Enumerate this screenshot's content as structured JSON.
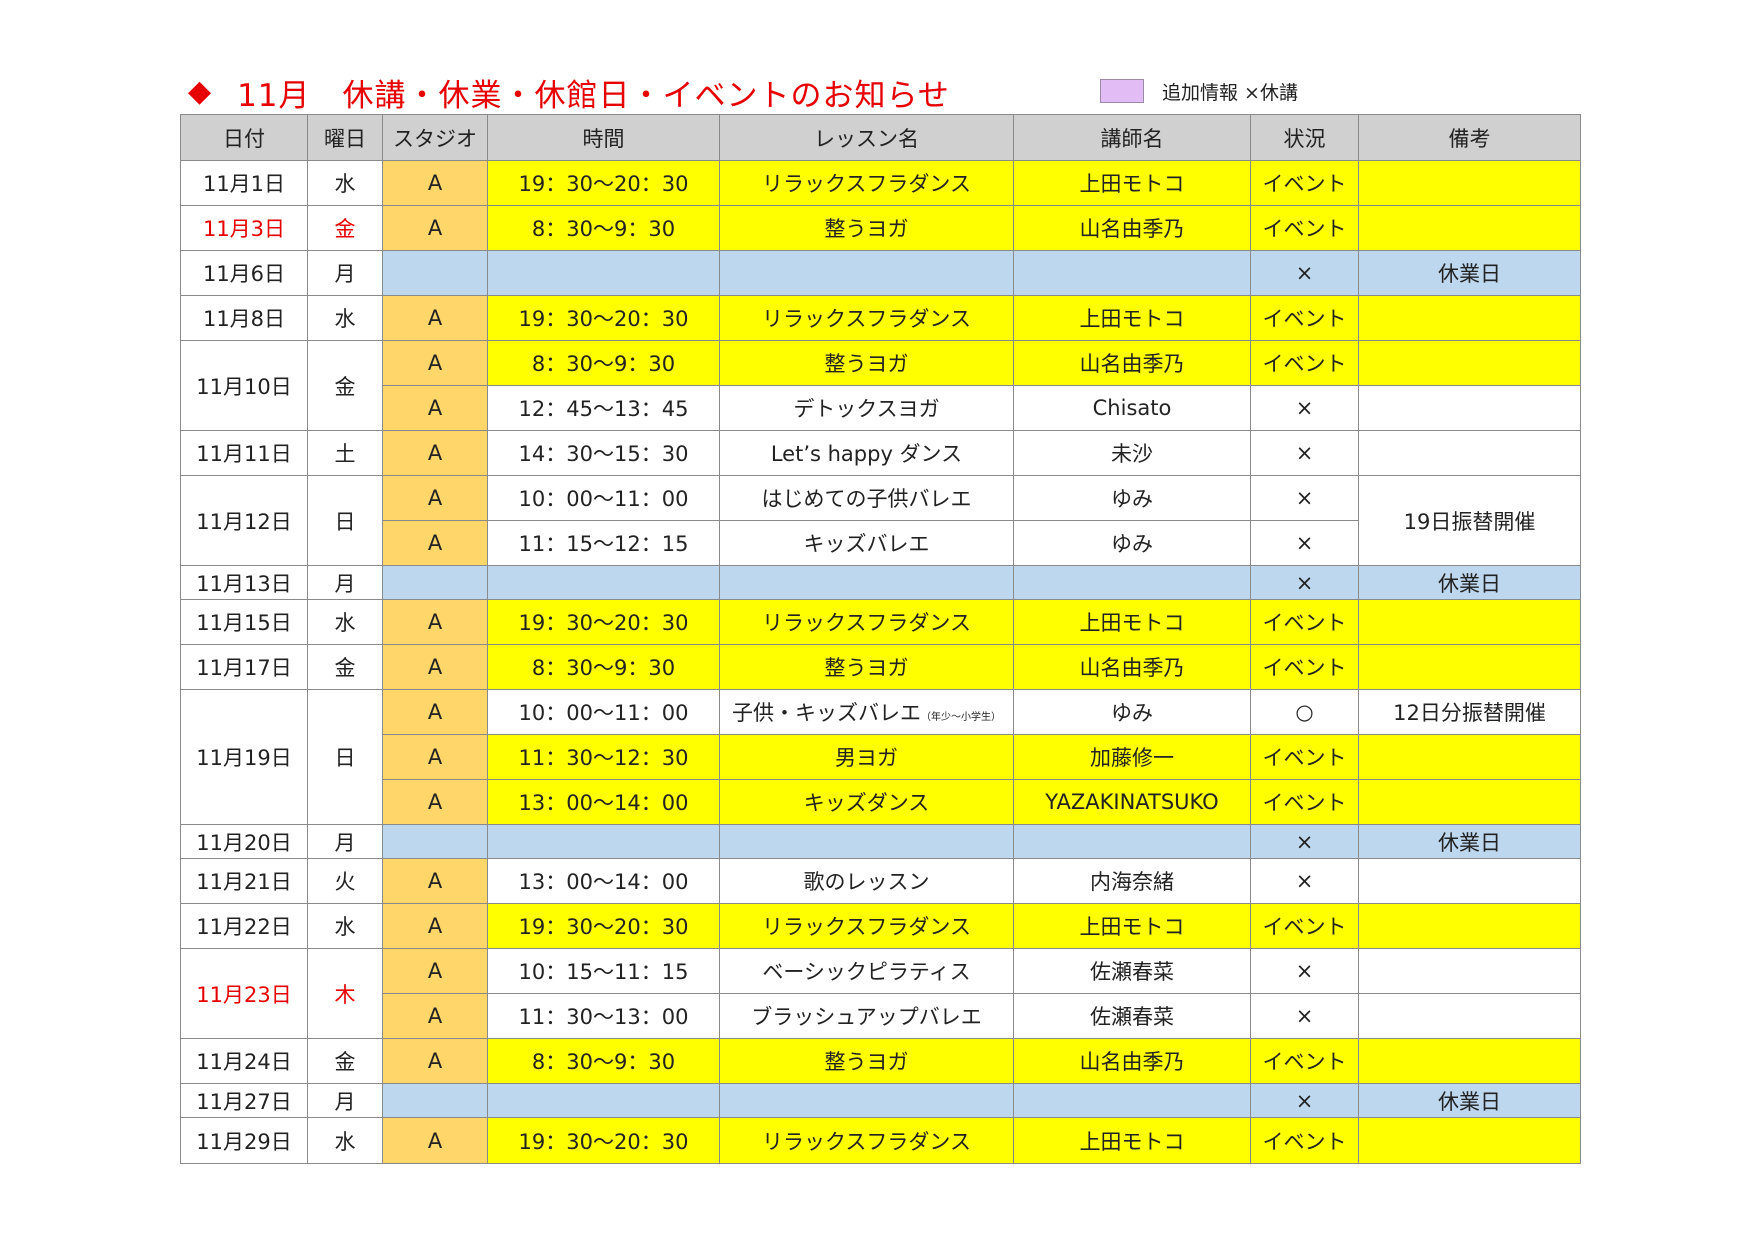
{
  "title": {
    "bullet": "◆",
    "text": "11月　休講・休業・休館日・イベントのお知らせ"
  },
  "legend": {
    "text": "追加情報 ×休講",
    "swatch_color": "#e2bdf5"
  },
  "colors": {
    "title_red": "#e60000",
    "header_gray": "#d0d0d0",
    "studio_orange": "#ffd66a",
    "event_yellow": "#ffff00",
    "closed_blue": "#bdd7ee"
  },
  "headers": [
    "日付",
    "曜日",
    "スタジオ",
    "時間",
    "レッスン名",
    "講師名",
    "状況",
    "備考"
  ],
  "rows": [
    {
      "date": "11月1日",
      "day": "水",
      "studio": "A",
      "time": "19：30～20：30",
      "lesson": "リラックスフラダンス",
      "teacher": "上田モトコ",
      "status": "イベント",
      "note": ""
    },
    {
      "date": "11月3日",
      "day": "金",
      "studio": "A",
      "time": "8：30～9：30",
      "lesson": "整うヨガ",
      "teacher": "山名由季乃",
      "status": "イベント",
      "note": ""
    },
    {
      "date": "11月6日",
      "day": "月",
      "studio": "",
      "time": "",
      "lesson": "",
      "teacher": "",
      "status": "×",
      "note": "休業日"
    },
    {
      "date": "11月8日",
      "day": "水",
      "studio": "A",
      "time": "19：30～20：30",
      "lesson": "リラックスフラダンス",
      "teacher": "上田モトコ",
      "status": "イベント",
      "note": ""
    },
    {
      "date": "11月10日",
      "day": "金",
      "studio": "A",
      "time": "8：30～9：30",
      "lesson": "整うヨガ",
      "teacher": "山名由季乃",
      "status": "イベント",
      "note": ""
    },
    {
      "date": "",
      "day": "",
      "studio": "A",
      "time": "12：45～13：45",
      "lesson": "デトックスヨガ",
      "teacher": "Chisato",
      "status": "×",
      "note": ""
    },
    {
      "date": "11月11日",
      "day": "土",
      "studio": "A",
      "time": "14：30～15：30",
      "lesson": "Let’s happy ダンス",
      "teacher": "未沙",
      "status": "×",
      "note": ""
    },
    {
      "date": "11月12日",
      "day": "日",
      "studio": "A",
      "time": "10：00～11：00",
      "lesson": "はじめての子供バレエ",
      "teacher": "ゆみ",
      "status": "×",
      "note": "19日振替開催"
    },
    {
      "date": "",
      "day": "",
      "studio": "A",
      "time": "11：15～12：15",
      "lesson": "キッズバレエ",
      "teacher": "ゆみ",
      "status": "×",
      "note": ""
    },
    {
      "date": "11月13日",
      "day": "月",
      "studio": "",
      "time": "",
      "lesson": "",
      "teacher": "",
      "status": "×",
      "note": "休業日"
    },
    {
      "date": "11月15日",
      "day": "水",
      "studio": "A",
      "time": "19：30～20：30",
      "lesson": "リラックスフラダンス",
      "teacher": "上田モトコ",
      "status": "イベント",
      "note": ""
    },
    {
      "date": "11月17日",
      "day": "金",
      "studio": "A",
      "time": "8：30～9：30",
      "lesson": "整うヨガ",
      "teacher": "山名由季乃",
      "status": "イベント",
      "note": ""
    },
    {
      "date": "11月19日",
      "day": "日",
      "studio": "A",
      "time": "10：00～11：00",
      "lesson": "子供・キッズバレエ",
      "lesson_small": "（年少～小学生）",
      "teacher": "ゆみ",
      "status": "○",
      "note": "12日分振替開催"
    },
    {
      "date": "",
      "day": "",
      "studio": "A",
      "time": "11：30～12：30",
      "lesson": "男ヨガ",
      "teacher": "加藤修一",
      "status": "イベント",
      "note": ""
    },
    {
      "date": "",
      "day": "",
      "studio": "A",
      "time": "13：00～14：00",
      "lesson": "キッズダンス",
      "teacher": "YAZAKINATSUKO",
      "status": "イベント",
      "note": ""
    },
    {
      "date": "11月20日",
      "day": "月",
      "studio": "",
      "time": "",
      "lesson": "",
      "teacher": "",
      "status": "×",
      "note": "休業日"
    },
    {
      "date": "11月21日",
      "day": "火",
      "studio": "A",
      "time": "13：00～14：00",
      "lesson": "歌のレッスン",
      "teacher": "内海奈緒",
      "status": "×",
      "note": ""
    },
    {
      "date": "11月22日",
      "day": "水",
      "studio": "A",
      "time": "19：30～20：30",
      "lesson": "リラックスフラダンス",
      "teacher": "上田モトコ",
      "status": "イベント",
      "note": ""
    },
    {
      "date": "11月23日",
      "day": "木",
      "studio": "A",
      "time": "10：15～11：15",
      "lesson": "ベーシックピラティス",
      "teacher": "佐瀬春菜",
      "status": "×",
      "note": ""
    },
    {
      "date": "",
      "day": "",
      "studio": "A",
      "time": "11：30～13：00",
      "lesson": "ブラッシュアップバレエ",
      "teacher": "佐瀬春菜",
      "status": "×",
      "note": ""
    },
    {
      "date": "11月24日",
      "day": "金",
      "studio": "A",
      "time": "8：30～9：30",
      "lesson": "整うヨガ",
      "teacher": "山名由季乃",
      "status": "イベント",
      "note": ""
    },
    {
      "date": "11月27日",
      "day": "月",
      "studio": "",
      "time": "",
      "lesson": "",
      "teacher": "",
      "status": "×",
      "note": "休業日"
    },
    {
      "date": "11月29日",
      "day": "水",
      "studio": "A",
      "time": "19：30～20：30",
      "lesson": "リラックスフラダンス",
      "teacher": "上田モトコ",
      "status": "イベント",
      "note": ""
    }
  ]
}
